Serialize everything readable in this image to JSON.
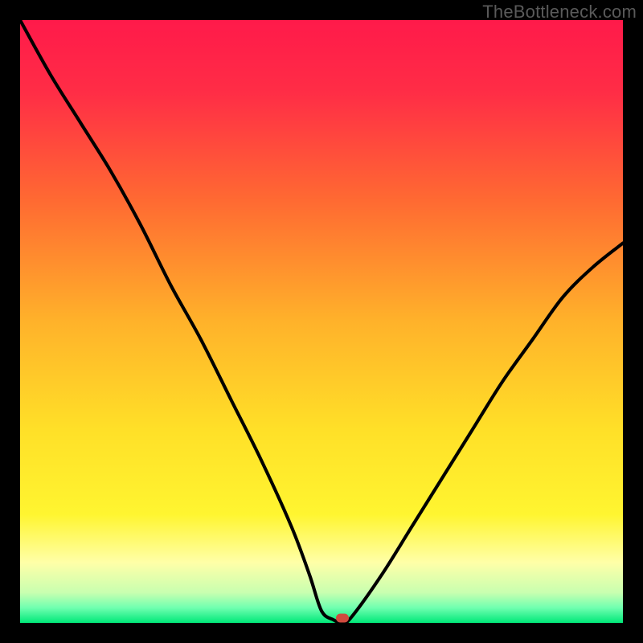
{
  "attribution": "TheBottleneck.com",
  "colors": {
    "gradient_stops": [
      {
        "pos": 0,
        "color": "#ff1a4a"
      },
      {
        "pos": 0.12,
        "color": "#ff2d46"
      },
      {
        "pos": 0.3,
        "color": "#ff6a32"
      },
      {
        "pos": 0.5,
        "color": "#ffb22a"
      },
      {
        "pos": 0.68,
        "color": "#ffe028"
      },
      {
        "pos": 0.82,
        "color": "#fff530"
      },
      {
        "pos": 0.9,
        "color": "#ffffa8"
      },
      {
        "pos": 0.95,
        "color": "#c8ffb0"
      },
      {
        "pos": 0.975,
        "color": "#6fffb0"
      },
      {
        "pos": 1.0,
        "color": "#00e878"
      }
    ],
    "curve": "#000000",
    "marker": "#d04a3e",
    "background": "#000000"
  },
  "chart_data": {
    "type": "line",
    "title": "",
    "xlabel": "",
    "ylabel": "",
    "xlim": [
      0,
      100
    ],
    "ylim": [
      0,
      100
    ],
    "grid": false,
    "legend": false,
    "series": [
      {
        "name": "bottleneck-curve",
        "x": [
          0,
          5,
          10,
          15,
          20,
          25,
          30,
          35,
          40,
          45,
          48,
          50,
          52,
          53.5,
          55,
          60,
          65,
          70,
          75,
          80,
          85,
          90,
          95,
          100
        ],
        "y": [
          100,
          91,
          83,
          75,
          66,
          56,
          47,
          37,
          27,
          16,
          8,
          2,
          0.5,
          0,
          1,
          8,
          16,
          24,
          32,
          40,
          47,
          54,
          59,
          63
        ]
      }
    ],
    "annotations": [
      {
        "name": "min-marker",
        "x": 53.5,
        "y": 0.8
      }
    ]
  }
}
